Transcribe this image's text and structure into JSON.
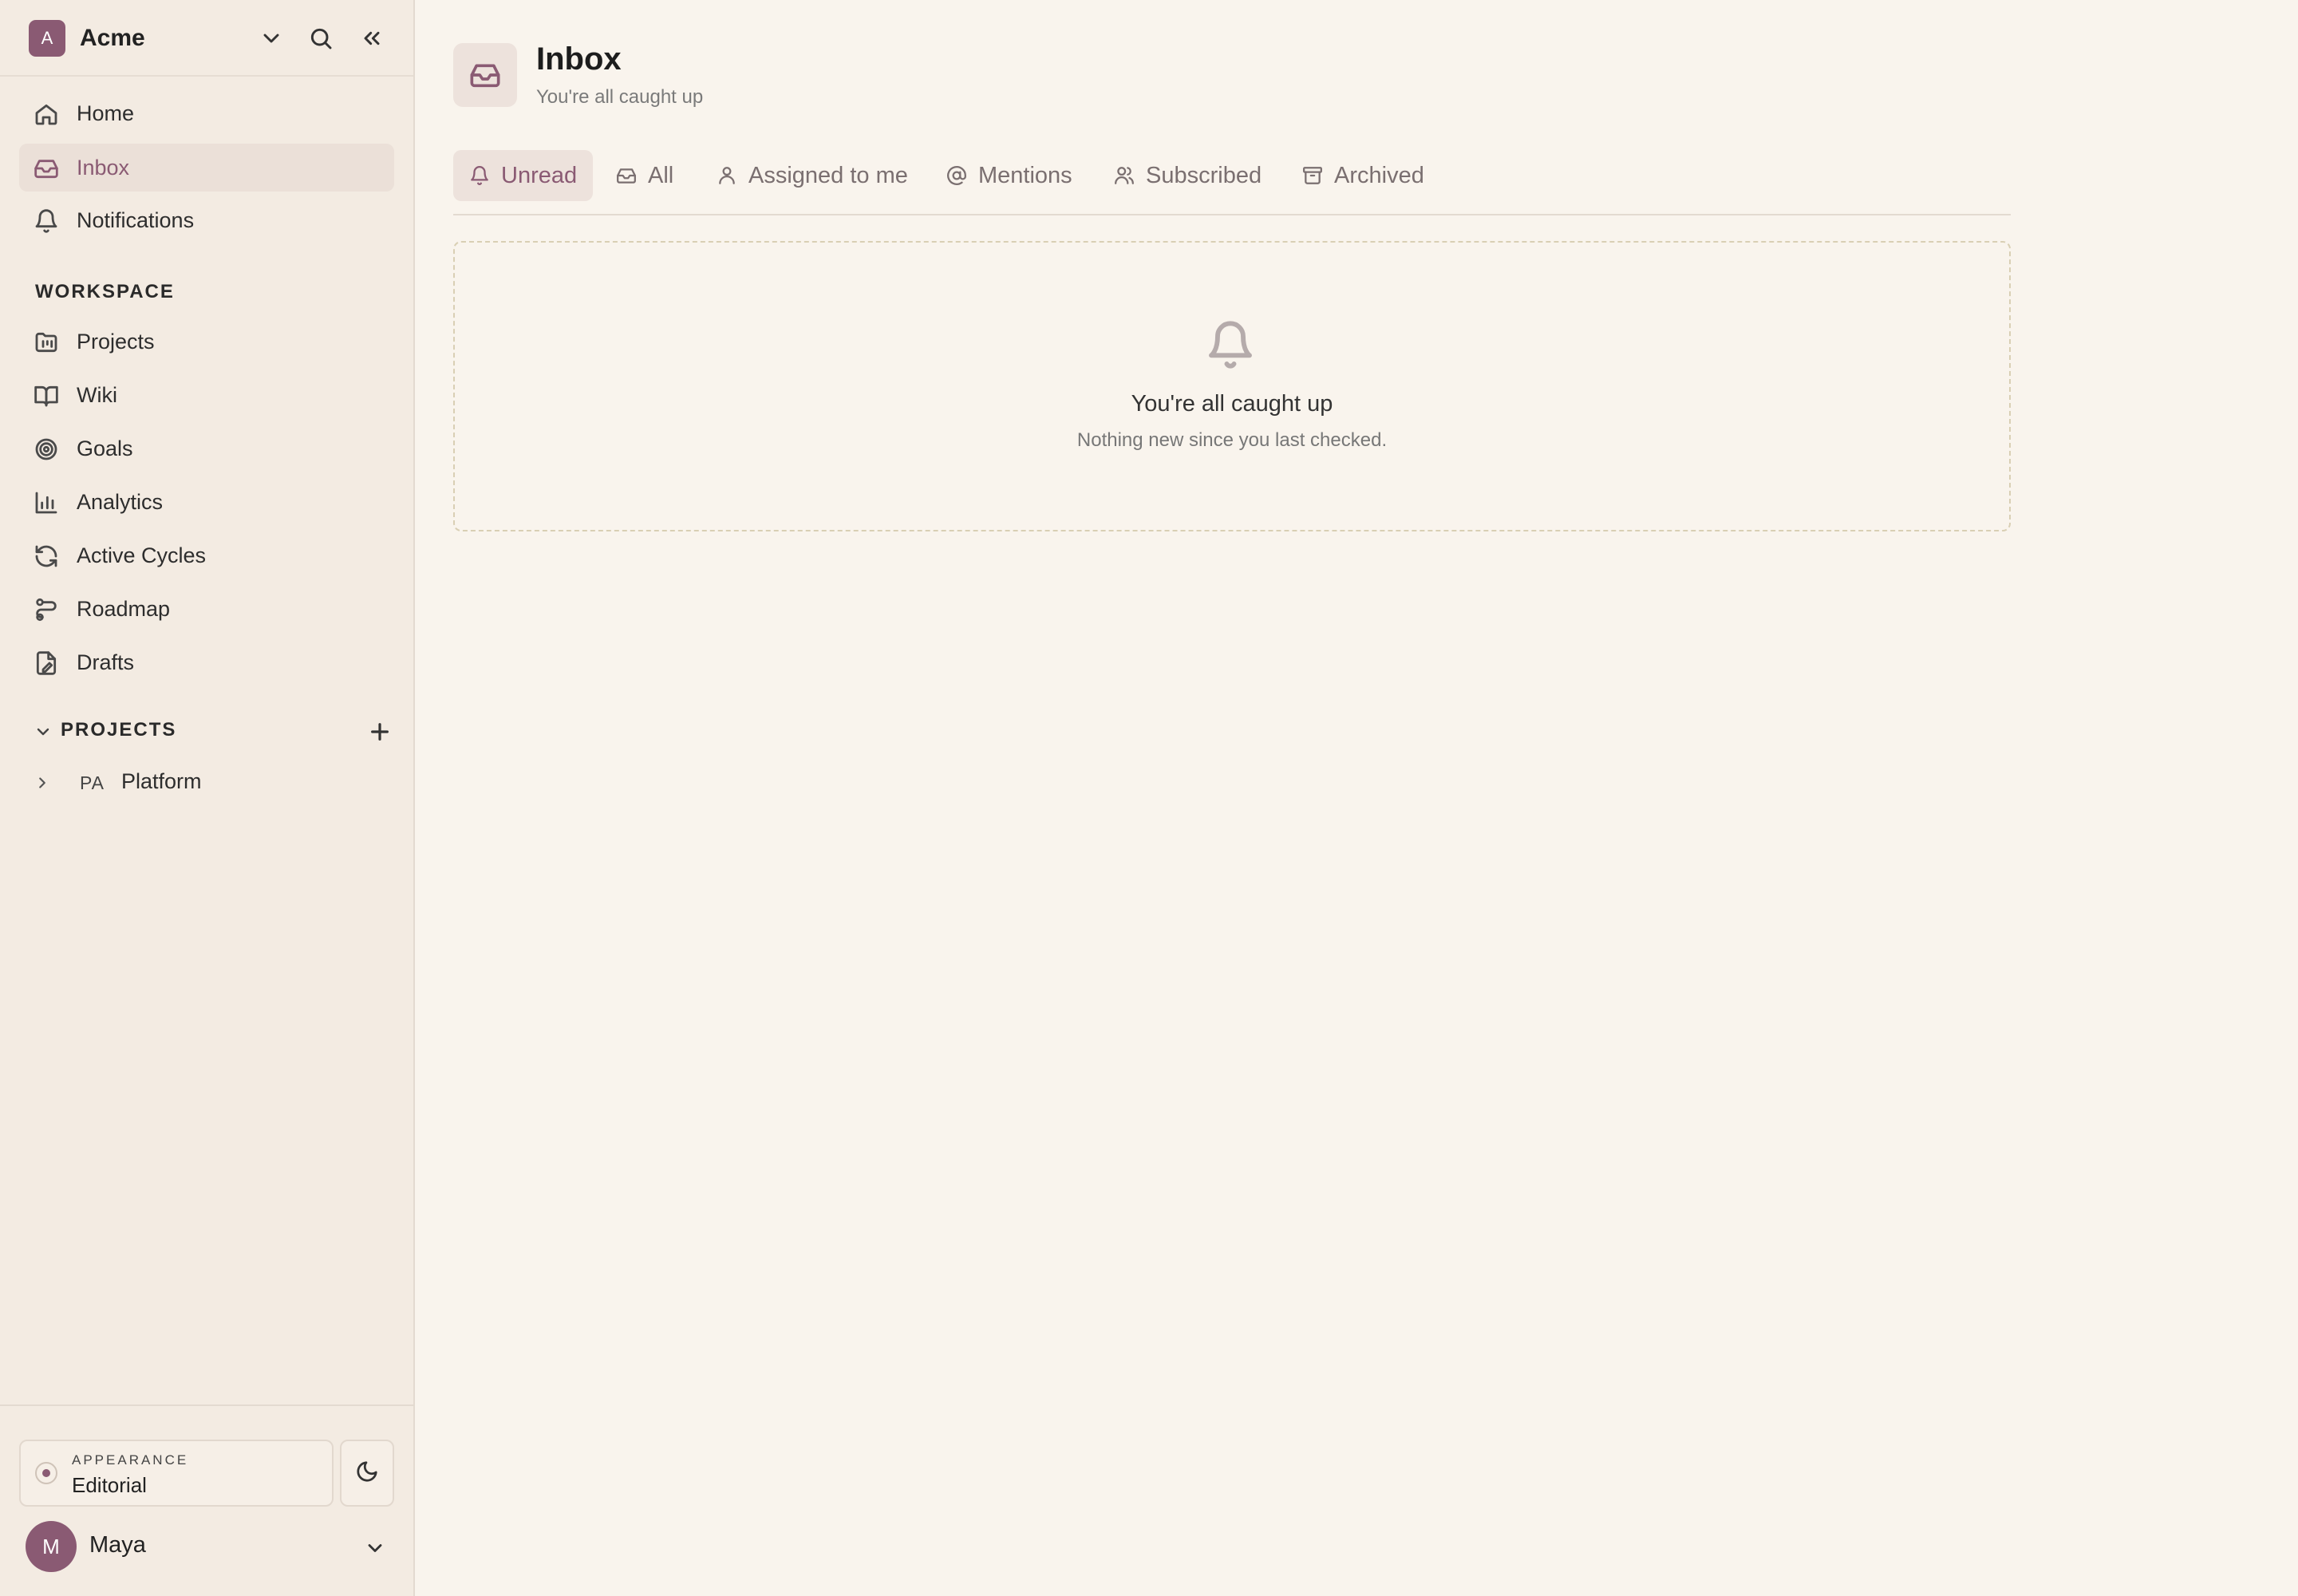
{
  "workspace": {
    "initial": "A",
    "name": "Acme"
  },
  "sidebar": {
    "nav": [
      {
        "label": "Home",
        "icon": "home-icon"
      },
      {
        "label": "Inbox",
        "icon": "inbox-icon",
        "active": true
      },
      {
        "label": "Notifications",
        "icon": "bell-icon"
      }
    ],
    "workspace_label": "WORKSPACE",
    "workspace_items": [
      {
        "label": "Projects",
        "icon": "projects-icon"
      },
      {
        "label": "Wiki",
        "icon": "book-icon"
      },
      {
        "label": "Goals",
        "icon": "target-icon"
      },
      {
        "label": "Analytics",
        "icon": "chart-icon"
      },
      {
        "label": "Active Cycles",
        "icon": "refresh-icon"
      },
      {
        "label": "Roadmap",
        "icon": "roadmap-icon"
      },
      {
        "label": "Drafts",
        "icon": "draft-icon"
      }
    ],
    "projects_label": "PROJECTS",
    "projects": [
      {
        "code": "PA",
        "name": "Platform"
      }
    ],
    "appearance": {
      "caption": "APPEARANCE",
      "value": "Editorial"
    },
    "user": {
      "initial": "M",
      "name": "Maya"
    }
  },
  "main": {
    "title": "Inbox",
    "subtitle": "You're all caught up",
    "tabs": [
      {
        "label": "Unread",
        "icon": "bell-icon",
        "active": true
      },
      {
        "label": "All",
        "icon": "inbox-icon"
      },
      {
        "label": "Assigned to me",
        "icon": "user-icon"
      },
      {
        "label": "Mentions",
        "icon": "at-icon"
      },
      {
        "label": "Subscribed",
        "icon": "users-icon"
      },
      {
        "label": "Archived",
        "icon": "archive-icon"
      }
    ],
    "empty": {
      "title": "You're all caught up",
      "description": "Nothing new since you last checked."
    }
  },
  "colors": {
    "accent": "#8a5a73",
    "background": "#f9f4ed",
    "sidebar": "#f3ebe2"
  }
}
